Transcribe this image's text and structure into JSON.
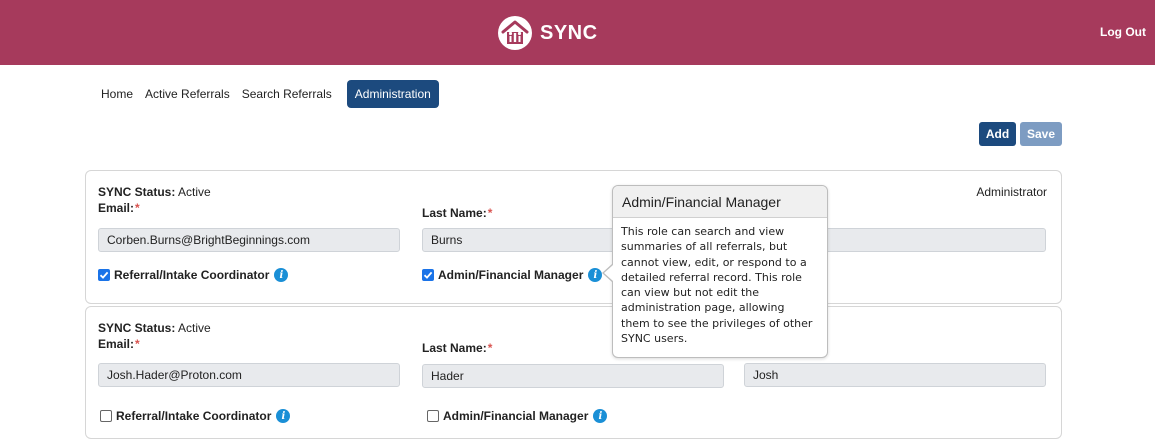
{
  "header": {
    "brand": "SYNC",
    "logout_label": "Log Out",
    "colors": {
      "bar": "#a63a5c",
      "primary": "#1c4a7e",
      "secondary": "#7d9cc2"
    },
    "logo_icon": "house-logo-icon"
  },
  "nav": {
    "items": [
      "Home",
      "Active Referrals",
      "Search Referrals",
      "Administration"
    ],
    "active": "Administration"
  },
  "actions": {
    "add_label": "Add",
    "save_label": "Save"
  },
  "users": [
    {
      "status_label": "SYNC Status:",
      "status_value": "Active",
      "email_label": "Email:",
      "email": "Corben.Burns@BrightBeginnings.com",
      "last_name_label": "Last Name:",
      "last_name": "Burns",
      "first_name": "",
      "role_tag": "Administrator",
      "roles": [
        {
          "label": "Referral/Intake Coordinator",
          "checked": true
        },
        {
          "label": "Admin/Financial Manager",
          "checked": true
        }
      ]
    },
    {
      "status_label": "SYNC Status:",
      "status_value": "Active",
      "email_label": "Email:",
      "email": "Josh.Hader@Proton.com",
      "last_name_label": "Last Name:",
      "last_name": "Hader",
      "first_name": "Josh",
      "roles": [
        {
          "label": "Referral/Intake Coordinator",
          "checked": false
        },
        {
          "label": "Admin/Financial Manager",
          "checked": false
        }
      ]
    }
  ],
  "tooltip": {
    "title": "Admin/Financial Manager",
    "lines": [
      "This role can search and view",
      "summaries of all referrals, but",
      "cannot view, edit, or respond to a",
      "detailed referral record. This role",
      "can view but not edit the",
      "administration page, allowing",
      "them to see the privileges of other",
      "SYNC users."
    ]
  }
}
